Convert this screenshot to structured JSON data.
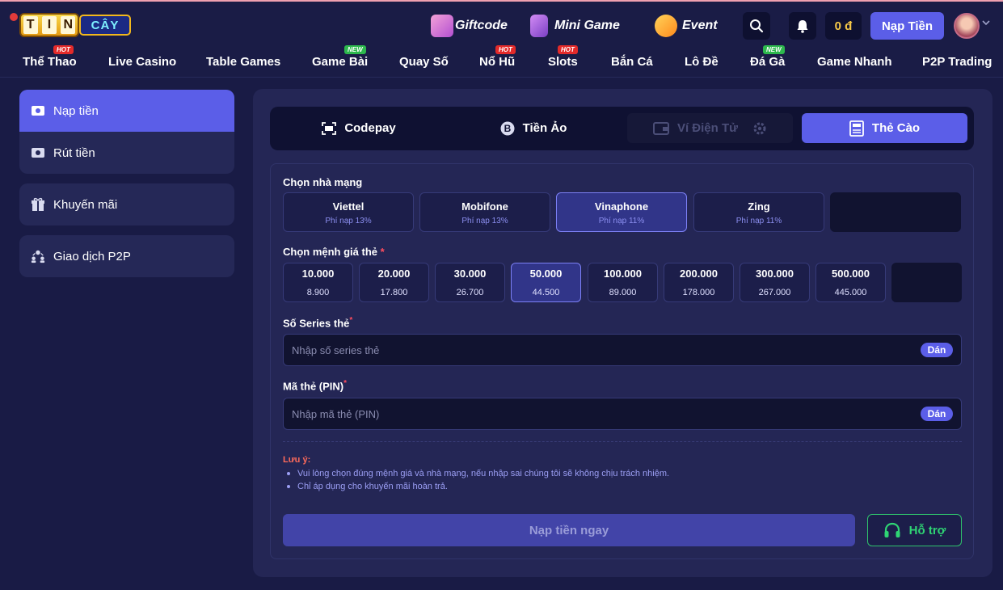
{
  "header": {
    "logo": {
      "reels": [
        "T",
        "I",
        "N"
      ],
      "suffix": "CÂY"
    },
    "promos": [
      {
        "label": "Giftcode",
        "icon": "gift-box-icon"
      },
      {
        "label": "Mini Game",
        "icon": "slot-machine-icon"
      },
      {
        "label": "Event",
        "icon": "megaphone-icon"
      }
    ],
    "balance": "0 đ",
    "deposit_label": "Nạp Tiền"
  },
  "nav": {
    "items": [
      {
        "label": "Thể Thao",
        "tag": "HOT"
      },
      {
        "label": "Live Casino",
        "tag": ""
      },
      {
        "label": "Table Games",
        "tag": ""
      },
      {
        "label": "Game Bài",
        "tag": "NEW"
      },
      {
        "label": "Quay Số",
        "tag": ""
      },
      {
        "label": "Nổ Hũ",
        "tag": "HOT"
      },
      {
        "label": "Slots",
        "tag": "HOT"
      },
      {
        "label": "Bắn Cá",
        "tag": ""
      },
      {
        "label": "Lô Đề",
        "tag": ""
      },
      {
        "label": "Đá Gà",
        "tag": "NEW"
      },
      {
        "label": "Game Nhanh",
        "tag": ""
      },
      {
        "label": "P2P Trading",
        "tag": ""
      }
    ]
  },
  "sidebar": {
    "items": [
      {
        "label": "Nạp tiền",
        "icon": "wallet-in-icon",
        "active": true
      },
      {
        "label": "Rút tiền",
        "icon": "wallet-out-icon",
        "active": false
      },
      {
        "label": "Khuyến mãi",
        "icon": "gift-icon",
        "active": false
      },
      {
        "label": "Giao dịch P2P",
        "icon": "users-exchange-icon",
        "active": false
      }
    ]
  },
  "tabs": [
    {
      "label": "Codepay",
      "icon": "qr-scan-icon",
      "state": "normal"
    },
    {
      "label": "Tiền Ảo",
      "icon": "bitcoin-icon",
      "state": "normal"
    },
    {
      "label": "Ví Điện Tử",
      "icon": "e-wallet-icon",
      "state": "disabled"
    },
    {
      "label": "Thẻ Cào",
      "icon": "scratch-card-icon",
      "state": "active"
    }
  ],
  "form": {
    "carrier_label": "Chọn nhà mạng",
    "carriers": [
      {
        "name": "Viettel",
        "fee": "Phí nạp 13%"
      },
      {
        "name": "Mobifone",
        "fee": "Phí nạp 13%"
      },
      {
        "name": "Vinaphone",
        "fee": "Phí nạp 11%"
      },
      {
        "name": "Zing",
        "fee": "Phí nạp 11%"
      }
    ],
    "selected_carrier": "Vinaphone",
    "denom_label": "Chọn mệnh giá thẻ",
    "required_mark": "*",
    "denominations": [
      {
        "value": "10.000",
        "price": "8.900"
      },
      {
        "value": "20.000",
        "price": "17.800"
      },
      {
        "value": "30.000",
        "price": "26.700"
      },
      {
        "value": "50.000",
        "price": "44.500"
      },
      {
        "value": "100.000",
        "price": "89.000"
      },
      {
        "value": "200.000",
        "price": "178.000"
      },
      {
        "value": "300.000",
        "price": "267.000"
      },
      {
        "value": "500.000",
        "price": "445.000"
      }
    ],
    "selected_denomination": "50.000",
    "serial_label": "Số Series thẻ",
    "serial_placeholder": "Nhập số series thẻ",
    "serial_value": "",
    "pin_label": "Mã thẻ (PIN)",
    "pin_placeholder": "Nhập mã thẻ (PIN)",
    "pin_value": "",
    "paste_label": "Dán",
    "note_title": "Lưu ý:",
    "notes": [
      "Vui lòng chọn đúng mệnh giá và nhà mạng, nếu nhập sai chúng tôi sẽ không chịu trách nhiệm.",
      "Chỉ áp dụng cho khuyến mãi hoàn trả."
    ],
    "submit_label": "Nạp tiền ngay",
    "support_label": "Hỗ trợ"
  },
  "colors": {
    "background": "#191b45",
    "panel": "#242655",
    "accent": "#5b5ee8",
    "support_green": "#2fd474",
    "balance_gold": "#f7c948"
  }
}
